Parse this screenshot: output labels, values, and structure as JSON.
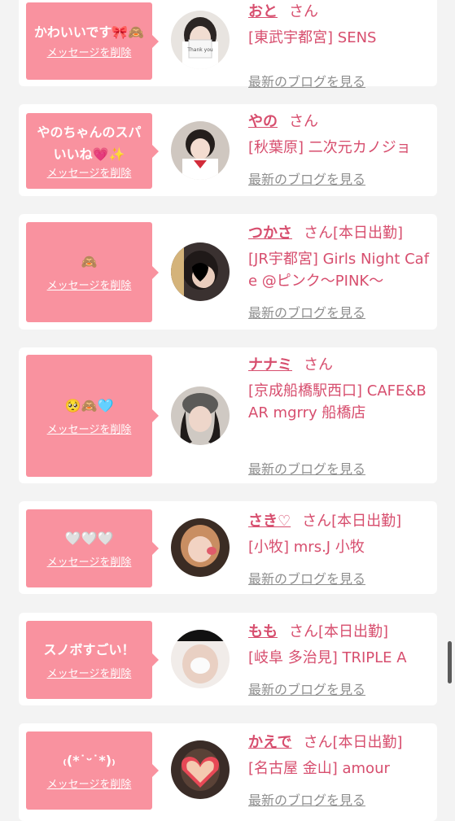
{
  "delete_label": "メッセージを削除",
  "blog_label": "最新のブログを見る",
  "san_suffix": "さん",
  "on_duty_label": "[本日出勤]",
  "items": [
    {
      "message": "かわいいです🎀🙈",
      "name": "おと",
      "shop": "[東武宇都宮] SENS",
      "on_duty": false
    },
    {
      "message": "やのちゃんのスパいいね💗✨",
      "name": "やの",
      "shop": "[秋葉原] 二次元カノジョ",
      "on_duty": false
    },
    {
      "message": "🙈",
      "name": "つかさ",
      "shop": "[JR宇都宮] Girls Night Cafe @ピンク〜PINK〜",
      "on_duty": true
    },
    {
      "message": "🥺🙈🩵",
      "name": "ナナミ",
      "shop": "[京成船橋駅西口] CAFE&BAR mgrry 船橋店",
      "on_duty": false
    },
    {
      "message": "🤍🤍🤍",
      "name": "さき♡",
      "shop": "[小牧] mrs.J 小牧",
      "on_duty": true
    },
    {
      "message": "スノボすごい！",
      "name": "もも",
      "shop": "[岐阜 多治見] TRIPLE A",
      "on_duty": true
    },
    {
      "message": "₍(*˙ᵕ˙*)₎",
      "name": "かえで",
      "shop": "[名古屋 金山] amour",
      "on_duty": true
    }
  ],
  "colors": {
    "page_bg": "#f3f3f3",
    "bubble": "#f9929f",
    "accent": "#d74e6e",
    "link_gray": "#8f8f8f"
  }
}
